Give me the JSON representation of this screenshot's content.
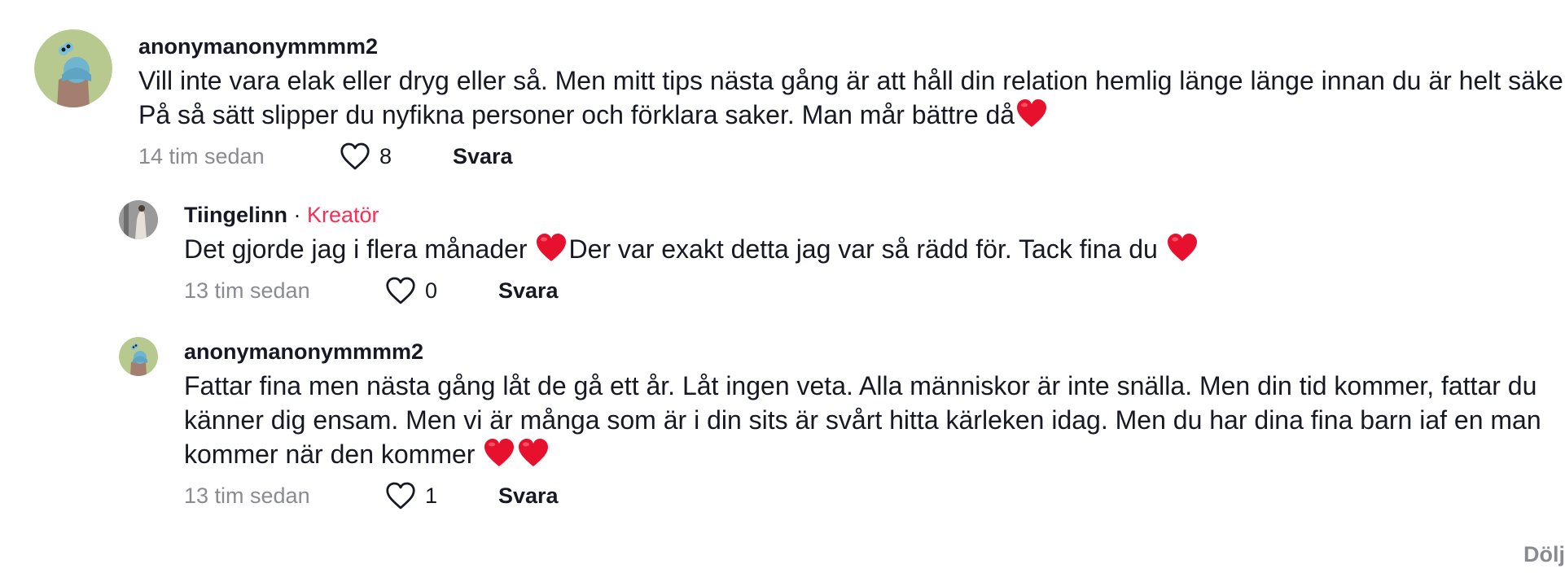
{
  "comments": [
    {
      "username": "anonymanonymmmm2",
      "text": "Vill inte vara elak eller dryg eller så. Men mitt tips nästa gång är att håll din relation hemlig länge länge innan du är helt säker. På så sätt slipper du nyfikna personer och förklara saker. Man mår bättre då",
      "emoji": "❤️",
      "time": "14 tim sedan",
      "likes": "8",
      "reply_label": "Svara",
      "avatar_icon": "cartoon-avatar-icon"
    }
  ],
  "replies": [
    {
      "username": "Tiingelinn",
      "separator": " · ",
      "badge": "Kreatör",
      "text_part1": "Det gjorde jag i flera månader ",
      "emoji1": "❤️",
      "text_part2": "Der var exakt detta jag var så rädd för. Tack fina du ",
      "emoji2": "❤️",
      "time": "13 tim sedan",
      "likes": "0",
      "reply_label": "Svara",
      "avatar_icon": "photo-avatar-icon"
    },
    {
      "username": "anonymanonymmmm2",
      "text": "Fattar fina men nästa gång låt de gå ett år. Låt ingen veta. Alla människor är inte snälla. Men din tid kommer, fattar du känner dig ensam. Men vi är många som är i din sits är svårt hitta kärleken idag. Men du har dina fina barn iaf en man kommer när den kommer ",
      "emoji": "❤️❤️",
      "time": "13 tim sedan",
      "likes": "1",
      "reply_label": "Svara",
      "avatar_icon": "cartoon-avatar-icon"
    }
  ],
  "hide_label": "Dölj",
  "colors": {
    "text": "#161823",
    "muted": "#8a8b91",
    "creator": "#fe2c55",
    "heart": "#e8112d"
  }
}
